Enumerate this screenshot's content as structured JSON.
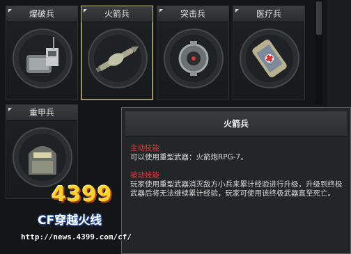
{
  "classes": [
    {
      "label": "爆破兵"
    },
    {
      "label": "火箭兵"
    },
    {
      "label": "突击兵"
    },
    {
      "label": "医疗兵"
    },
    {
      "label": "重甲兵"
    }
  ],
  "tooltip": {
    "title": "火箭兵",
    "active_title": "主动技能",
    "active_text": "可以使用重型武器：火箭炮RPG-7。",
    "passive_title": "被动技能",
    "passive_text": "玩家使用重型武器消灭敌方小兵来累计经验进行升级，升级到终极武器后将无法继续累计经验，玩家可使用该终极武器直至死亡。"
  },
  "watermark": {
    "brand": "4399",
    "title": "CF穿越火线",
    "url": "http://news.4399.com/cf/"
  },
  "colors": {
    "selected_border": "#c9c28a",
    "section_title": "#e23a3a",
    "brand_yellow": "#ffd12b"
  }
}
